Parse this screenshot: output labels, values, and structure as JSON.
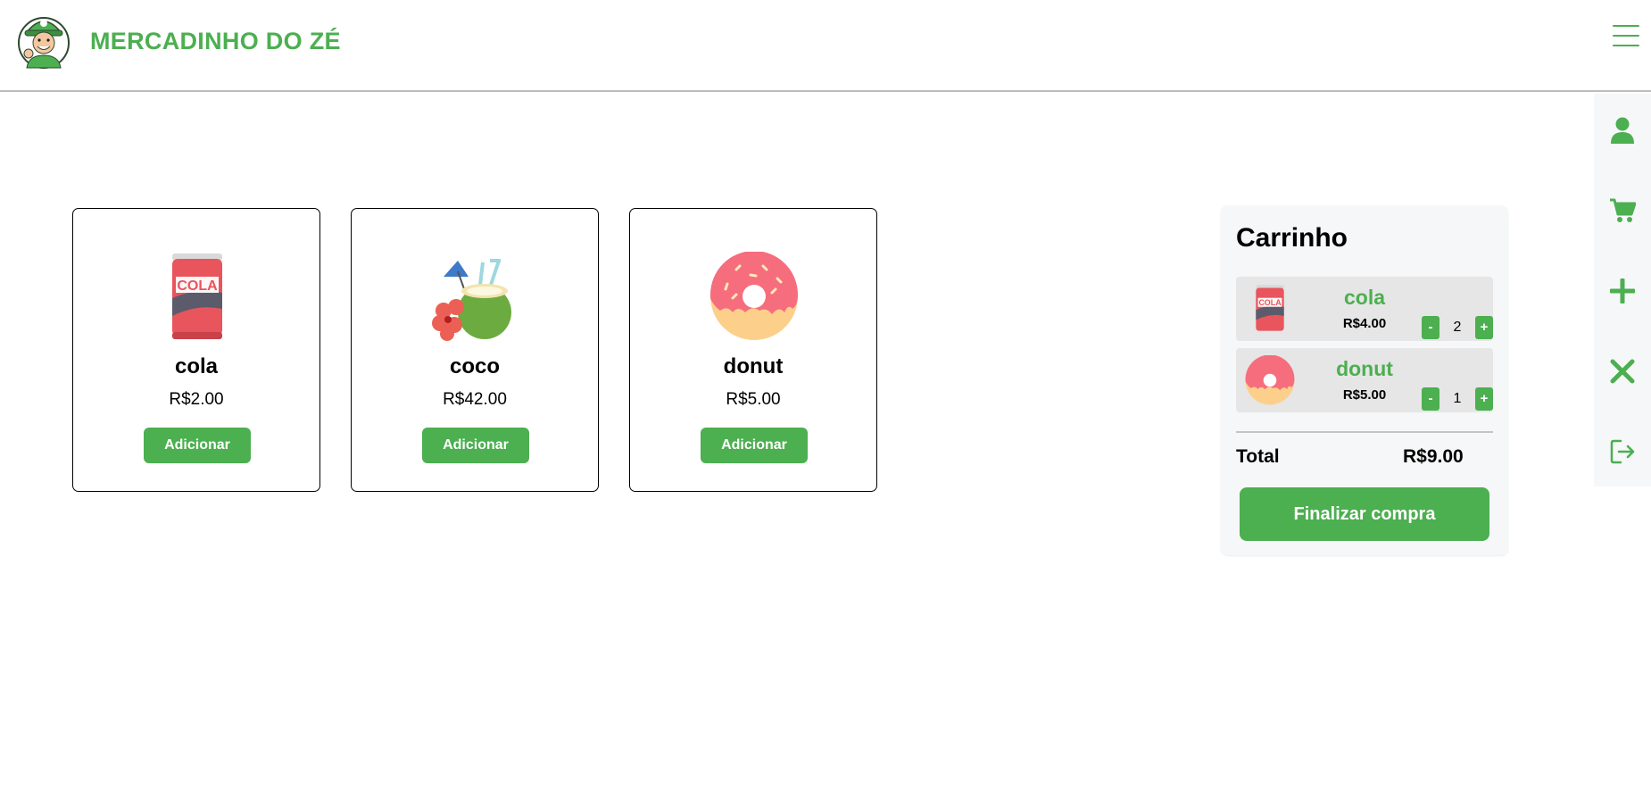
{
  "header": {
    "brand": "MERCADINHO DO ZÉ",
    "menu_icon": "hamburger-menu-icon"
  },
  "sidebar": {
    "items": [
      {
        "name": "profile",
        "icon": "user-icon"
      },
      {
        "name": "cart",
        "icon": "cart-icon"
      },
      {
        "name": "add",
        "icon": "plus-icon"
      },
      {
        "name": "close",
        "icon": "close-icon"
      },
      {
        "name": "logout",
        "icon": "logout-icon"
      }
    ]
  },
  "products": [
    {
      "name": "cola",
      "price": "R$2.00",
      "button": "Adicionar",
      "image": "cola-can-icon"
    },
    {
      "name": "coco",
      "price": "R$42.00",
      "button": "Adicionar",
      "image": "coconut-drink-icon"
    },
    {
      "name": "donut",
      "price": "R$5.00",
      "button": "Adicionar",
      "image": "donut-icon"
    }
  ],
  "cart": {
    "title": "Carrinho",
    "items": [
      {
        "name": "cola",
        "price": "R$4.00",
        "quantity": "2",
        "minus": "-",
        "plus": "+"
      },
      {
        "name": "donut",
        "price": "R$5.00",
        "quantity": "1",
        "minus": "-",
        "plus": "+"
      }
    ],
    "total_label": "Total",
    "total_value": "R$9.00",
    "checkout_label": "Finalizar compra"
  },
  "colors": {
    "accent": "#4caf50",
    "sidebar_bg": "#f6f7f8",
    "cart_item_bg": "#e6e6e6"
  }
}
